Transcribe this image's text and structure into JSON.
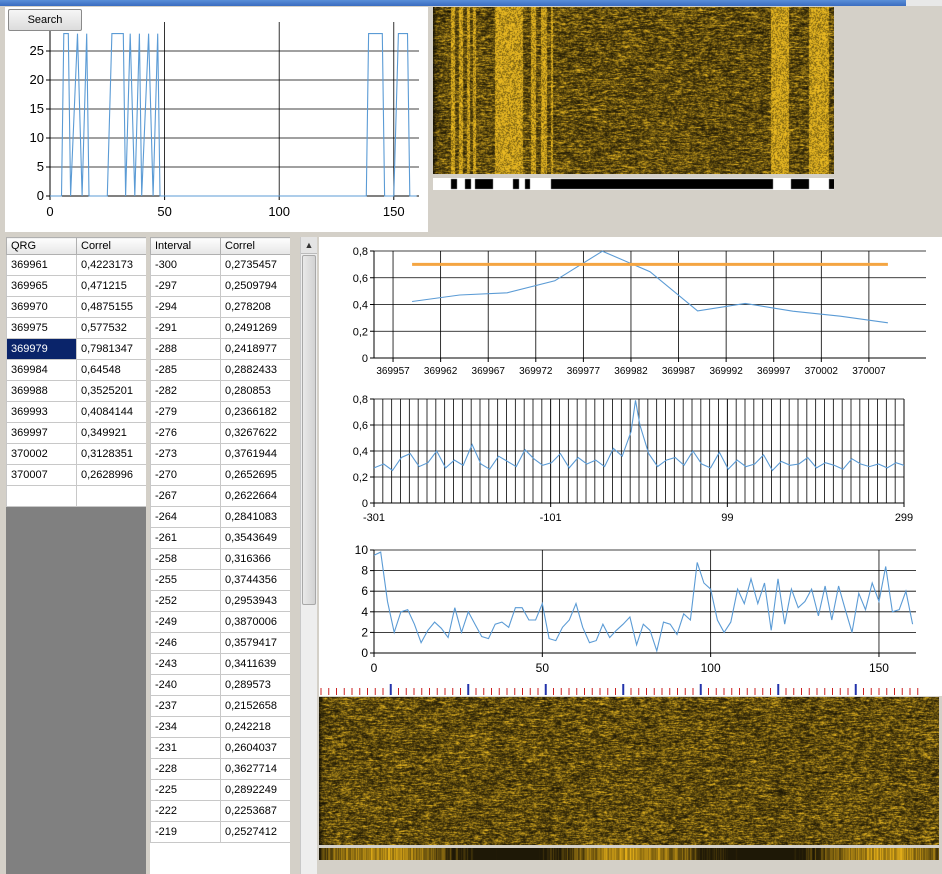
{
  "toolbar": {
    "search_label": "Search"
  },
  "chart_data": [
    {
      "type": "line",
      "x": [
        0,
        5,
        6,
        8,
        9,
        12,
        14,
        16,
        17,
        25,
        27,
        32,
        33,
        35,
        37,
        39,
        40,
        43,
        45,
        47,
        48,
        100,
        138,
        139,
        141,
        143,
        145,
        146,
        150,
        152,
        154,
        156,
        157,
        160
      ],
      "series": [
        {
          "values": [
            0,
            0,
            28,
            28,
            0,
            28,
            0,
            28,
            0,
            0,
            28,
            28,
            0,
            28,
            0,
            28,
            0,
            28,
            0,
            28,
            0,
            0,
            0,
            28,
            28,
            28,
            28,
            0,
            0,
            28,
            28,
            28,
            0,
            0
          ]
        }
      ],
      "xticks": [
        "0",
        "50",
        "100",
        "150"
      ],
      "yticks": [
        "0",
        "5",
        "10",
        "15",
        "20",
        "25"
      ],
      "xlim": [
        0,
        161
      ],
      "ylim": [
        0,
        30
      ],
      "grid": true
    },
    {
      "type": "line",
      "x": [
        369959,
        369964,
        369969,
        369974,
        369979,
        369984,
        369989,
        369994,
        369999,
        370004,
        370009
      ],
      "series": [
        {
          "values": [
            0.4223173,
            0.471215,
            0.4875155,
            0.577532,
            0.7981347,
            0.64548,
            0.3525201,
            0.4084144,
            0.349921,
            0.3128351,
            0.2628996
          ]
        },
        {
          "values": [
            0.7,
            0.7,
            0.7,
            0.7,
            0.7,
            0.7,
            0.7,
            0.7,
            0.7,
            0.7,
            0.7
          ]
        }
      ],
      "xticks": [
        "369957",
        "369962",
        "369967",
        "369972",
        "369977",
        "369982",
        "369987",
        "369992",
        "369997",
        "370002",
        "370007"
      ],
      "yticks": [
        "0",
        "0,2",
        "0,4",
        "0,6",
        "0,8"
      ],
      "xlim": [
        369955,
        370013
      ],
      "ylim": [
        0,
        0.8
      ],
      "grid": true
    },
    {
      "type": "line",
      "x": [
        -301,
        -290,
        -280,
        -270,
        -260,
        -250,
        -240,
        -230,
        -220,
        -210,
        -200,
        -190,
        -180,
        -170,
        -160,
        -150,
        -140,
        -130,
        -120,
        -110,
        -100,
        -90,
        -80,
        -70,
        -60,
        -50,
        -40,
        -30,
        -20,
        -10,
        -5,
        0,
        10,
        20,
        30,
        40,
        50,
        60,
        70,
        80,
        90,
        100,
        110,
        120,
        130,
        140,
        150,
        160,
        170,
        180,
        190,
        200,
        210,
        220,
        230,
        240,
        250,
        260,
        270,
        280,
        290,
        299
      ],
      "series": [
        {
          "values": [
            0.27,
            0.3,
            0.25,
            0.35,
            0.38,
            0.28,
            0.31,
            0.4,
            0.27,
            0.33,
            0.29,
            0.45,
            0.3,
            0.26,
            0.36,
            0.32,
            0.28,
            0.41,
            0.34,
            0.29,
            0.31,
            0.38,
            0.27,
            0.35,
            0.3,
            0.33,
            0.28,
            0.42,
            0.36,
            0.55,
            0.79,
            0.6,
            0.38,
            0.28,
            0.33,
            0.35,
            0.29,
            0.4,
            0.3,
            0.27,
            0.39,
            0.26,
            0.33,
            0.28,
            0.3,
            0.37,
            0.25,
            0.32,
            0.29,
            0.3,
            0.35,
            0.27,
            0.31,
            0.29,
            0.26,
            0.34,
            0.3,
            0.28,
            0.3,
            0.27,
            0.31,
            0.29
          ]
        }
      ],
      "xticks": [
        "-301",
        "-101",
        "99",
        "299"
      ],
      "yticks": [
        "0",
        "0,2",
        "0,4",
        "0,6",
        "0,8"
      ],
      "xlim": [
        -301,
        299
      ],
      "ylim": [
        0,
        0.8
      ],
      "grid": true
    },
    {
      "type": "line",
      "x": [
        0,
        2,
        4,
        6,
        8,
        10,
        12,
        14,
        16,
        18,
        20,
        22,
        24,
        26,
        28,
        30,
        32,
        34,
        36,
        38,
        40,
        42,
        44,
        46,
        48,
        50,
        52,
        54,
        56,
        58,
        60,
        62,
        64,
        66,
        68,
        70,
        72,
        74,
        76,
        78,
        80,
        82,
        84,
        86,
        88,
        90,
        92,
        94,
        96,
        98,
        100,
        102,
        104,
        106,
        108,
        110,
        112,
        114,
        116,
        118,
        120,
        122,
        124,
        126,
        128,
        130,
        132,
        134,
        136,
        138,
        140,
        142,
        144,
        146,
        148,
        150,
        152,
        154,
        156,
        158,
        160
      ],
      "series": [
        {
          "values": [
            9.5,
            9.8,
            5,
            2,
            4,
            4.2,
            2.8,
            1,
            2.2,
            3,
            2.4,
            1.5,
            4.4,
            2,
            4,
            2.8,
            1.6,
            1.4,
            2.8,
            3,
            2.5,
            4.4,
            4.4,
            3.2,
            3.2,
            4.8,
            1.4,
            1.2,
            2.5,
            3.2,
            4.8,
            2.5,
            1,
            1.2,
            2.8,
            1.5,
            2.2,
            2.8,
            3.5,
            0.8,
            2.8,
            2.2,
            0.2,
            3,
            2.8,
            1.8,
            3.8,
            3.2,
            8.8,
            6.8,
            6.2,
            3.2,
            2,
            3,
            6.2,
            4.8,
            7.2,
            4.8,
            6.8,
            2.2,
            7.2,
            2.8,
            6.2,
            4.4,
            5,
            6.2,
            3.6,
            6.5,
            3.2,
            6.5,
            4.2,
            2,
            5.8,
            4.2,
            6.8,
            5,
            8.4,
            4,
            4.2,
            6,
            2.8
          ]
        }
      ],
      "xticks": [
        "0",
        "50",
        "100",
        "150"
      ],
      "yticks": [
        "0",
        "2",
        "4",
        "6",
        "8",
        "10"
      ],
      "xlim": [
        0,
        161
      ],
      "ylim": [
        0,
        10
      ],
      "grid": true
    }
  ],
  "qrg_table": {
    "headers": [
      "QRG",
      "Correl"
    ],
    "rows": [
      [
        "369961",
        "0,4223173"
      ],
      [
        "369965",
        "0,471215"
      ],
      [
        "369970",
        "0,4875155"
      ],
      [
        "369975",
        "0,577532"
      ],
      [
        "369979",
        "0,7981347"
      ],
      [
        "369984",
        "0,64548"
      ],
      [
        "369988",
        "0,3525201"
      ],
      [
        "369993",
        "0,4084144"
      ],
      [
        "369997",
        "0,349921"
      ],
      [
        "370002",
        "0,3128351"
      ],
      [
        "370007",
        "0,2628996"
      ],
      [
        "",
        ""
      ]
    ],
    "selected_index": 4
  },
  "interval_table": {
    "headers": [
      "Interval",
      "Correl"
    ],
    "rows": [
      [
        "-300",
        "0,2735457"
      ],
      [
        "-297",
        "0,2509794"
      ],
      [
        "-294",
        "0,278208"
      ],
      [
        "-291",
        "0,2491269"
      ],
      [
        "-288",
        "0,2418977"
      ],
      [
        "-285",
        "0,2882433"
      ],
      [
        "-282",
        "0,280853"
      ],
      [
        "-279",
        "0,2366182"
      ],
      [
        "-276",
        "0,3267622"
      ],
      [
        "-273",
        "0,3761944"
      ],
      [
        "-270",
        "0,2652695"
      ],
      [
        "-267",
        "0,2622664"
      ],
      [
        "-264",
        "0,2841083"
      ],
      [
        "-261",
        "0,3543649"
      ],
      [
        "-258",
        "0,316366"
      ],
      [
        "-255",
        "0,3744356"
      ],
      [
        "-252",
        "0,2953943"
      ],
      [
        "-249",
        "0,3870006"
      ],
      [
        "-246",
        "0,3579417"
      ],
      [
        "-243",
        "0,3411639"
      ],
      [
        "-240",
        "0,289573"
      ],
      [
        "-237",
        "0,2152658"
      ],
      [
        "-234",
        "0,242218"
      ],
      [
        "-231",
        "0,2604037"
      ],
      [
        "-228",
        "0,3627714"
      ],
      [
        "-225",
        "0,2892249"
      ],
      [
        "-222",
        "0,2253687"
      ],
      [
        "-219",
        "0,2527412"
      ]
    ]
  },
  "colors": {
    "series": "#5b9bd5",
    "threshold": "#f4a542",
    "waterfall_dark": "#1a1305",
    "waterfall_gold": "#e8b820",
    "selection": "#0a246a",
    "ruler_red": "#cc2222",
    "ruler_blue": "#2233aa"
  },
  "icons": {
    "scroll_up": "triangle-up-icon"
  }
}
